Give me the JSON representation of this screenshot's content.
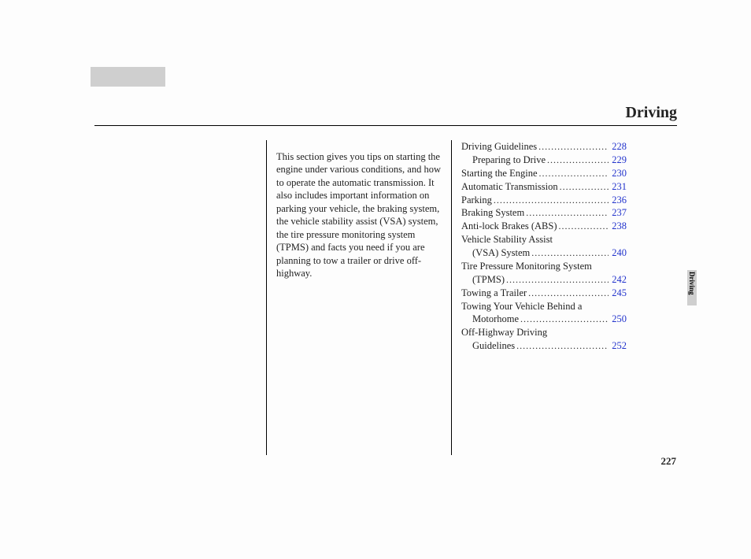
{
  "header": {
    "title": "Driving"
  },
  "side_tab": {
    "label": "Driving"
  },
  "intro": {
    "text": "This section gives you tips on starting the engine under various conditions, and how to operate the automatic transmission. It also includes important information on parking your vehicle, the braking system, the vehicle stability assist (VSA) system, the tire pressure monitoring system (TPMS) and facts you need if you are planning to tow a trailer or drive off-highway."
  },
  "toc": {
    "items": [
      {
        "label": "Driving Guidelines",
        "page": "228",
        "indent": false,
        "cont": null
      },
      {
        "label": "Preparing to Drive",
        "page": "229",
        "indent": true,
        "cont": null
      },
      {
        "label": "Starting the Engine",
        "page": "230",
        "indent": false,
        "cont": null
      },
      {
        "label": "Automatic Transmission",
        "page": "231",
        "indent": false,
        "cont": null
      },
      {
        "label": "Parking",
        "page": "236",
        "indent": false,
        "cont": null
      },
      {
        "label": "Braking System",
        "page": "237",
        "indent": false,
        "cont": null
      },
      {
        "label": "Anti-lock Brakes (ABS)",
        "page": "238",
        "indent": false,
        "cont": null
      },
      {
        "label": "Vehicle Stability Assist",
        "page": "240",
        "indent": false,
        "cont": "(VSA) System"
      },
      {
        "label": "Tire Pressure Monitoring System",
        "page": "242",
        "indent": false,
        "cont": "(TPMS)"
      },
      {
        "label": "Towing a Trailer",
        "page": "245",
        "indent": false,
        "cont": null
      },
      {
        "label": "Towing Your Vehicle Behind a",
        "page": "250",
        "indent": false,
        "cont": "Motorhome"
      },
      {
        "label": "Off-Highway Driving",
        "page": "252",
        "indent": false,
        "cont": "Guidelines"
      }
    ]
  },
  "page_number": "227"
}
